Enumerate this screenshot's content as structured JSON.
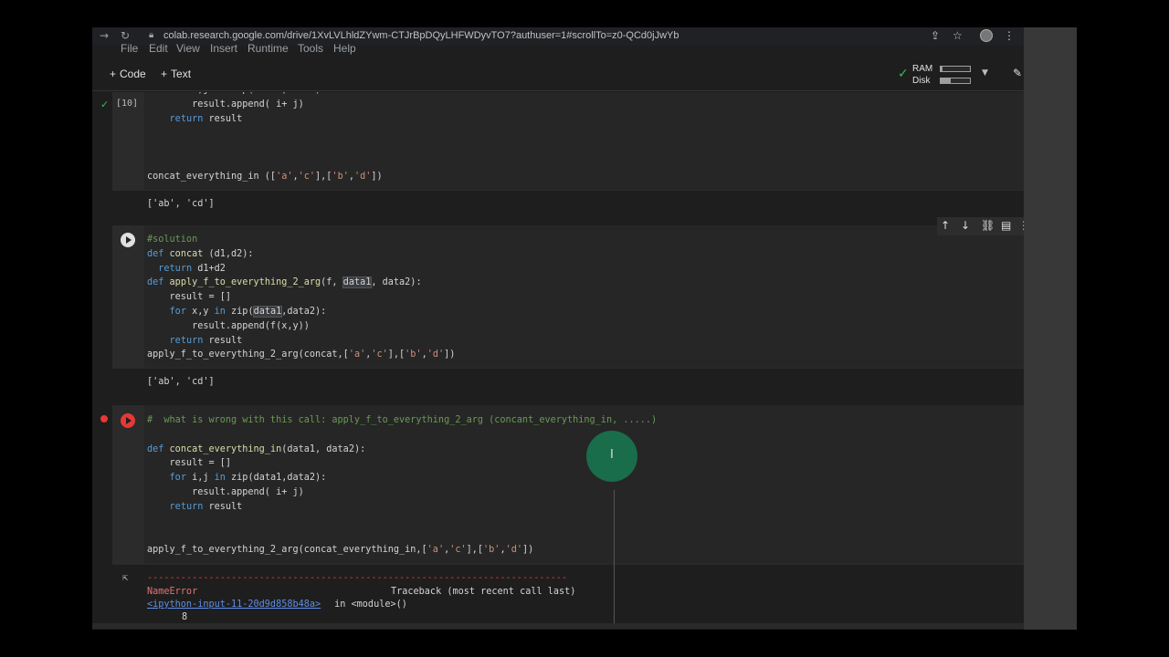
{
  "browser": {
    "url": "colab.research.google.com/drive/1XvLVLhldZYwm-CTJrBpDQyLHFWDyvTO7?authuser=1#scrollTo=z0-QCd0jJwYb"
  },
  "menu": [
    "File",
    "Edit",
    "View",
    "Insert",
    "Runtime",
    "Tools",
    "Help"
  ],
  "toolbar": {
    "add_code": "Code",
    "add_text": "Text",
    "ram_label": "RAM",
    "disk_label": "Disk",
    "ram_usage": 0.05,
    "disk_usage": 0.35
  },
  "cells": {
    "cell1": {
      "exec_count": "[10]",
      "output": "['ab', 'cd']"
    },
    "cell2": {
      "output": "['ab', 'cd']"
    },
    "cell3": {
      "traceback_dashes": "---------------------------------------------------------------------------",
      "error_name": "NameError",
      "traceback_header": "Traceback (most recent call last)",
      "input_link": "<ipython-input-11-20d9d858b48a>",
      "in_module": " in <module>()",
      "line_no": "8"
    }
  },
  "colors": {
    "background": "#1e1e1e",
    "keyword": "#569cd6",
    "string": "#ce9178",
    "comment": "#6a9955",
    "error": "#e53935",
    "success": "#3fb950",
    "link": "#5e8ee6"
  },
  "icons": [
    "back-icon",
    "reload-icon",
    "lock-icon",
    "share-icon",
    "star-icon",
    "menu-dots-icon",
    "check-icon",
    "pencil-icon",
    "arrow-up-icon",
    "arrow-down-icon",
    "link-icon",
    "comment-icon",
    "run-icon",
    "error-icon",
    "output-icon"
  ]
}
